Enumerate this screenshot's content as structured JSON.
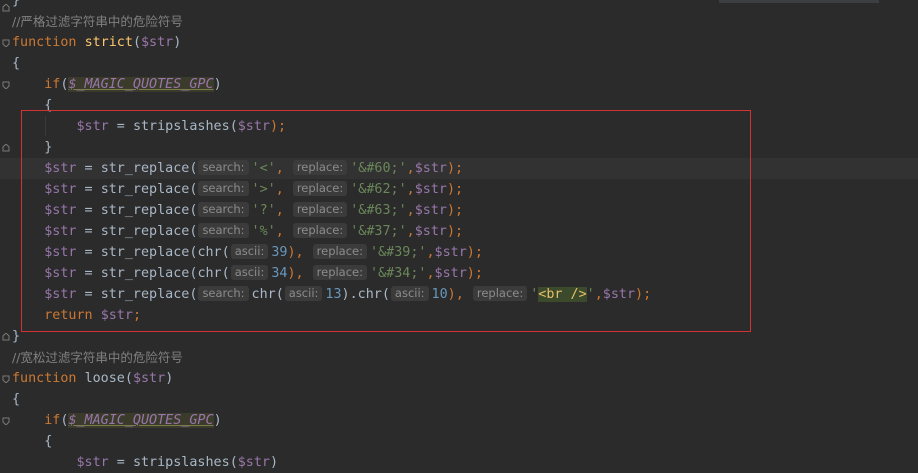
{
  "editor": {
    "lines": {
      "l0": "}",
      "c1": "//严格过滤字符串中的危险符号",
      "f1_kw": "function",
      "f1_name": "strict",
      "f1_open": "(",
      "f1_arg": "$str",
      "f1_close": ")",
      "brace_open": "{",
      "if_kw": "if",
      "if_open": "(",
      "gpc": "$_MAGIC_QUOTES_GPC",
      "if_close": ")",
      "inner_open": "{",
      "ss_var": "$str",
      "ss_eq": " = ",
      "ss_fn": "stripslashes",
      "ss_open": "(",
      "ss_arg": "$str",
      "ss_close": ");",
      "inner_close": "}",
      "r1": {
        "var": "$str",
        "eq": " = ",
        "fn": "str_replace",
        "open": "(",
        "h1": "search:",
        "s1": "'<'",
        "comma": ", ",
        "h2": "replace:",
        "s2": "'&#60;'",
        "tail_comma": ",",
        "arg": "$str",
        "end": ");"
      },
      "r2": {
        "var": "$str",
        "eq": " = ",
        "fn": "str_replace",
        "open": "(",
        "h1": "search:",
        "s1": "'>'",
        "comma": ", ",
        "h2": "replace:",
        "s2": "'&#62;'",
        "tail_comma": ",",
        "arg": "$str",
        "end": ");"
      },
      "r3": {
        "var": "$str",
        "eq": " = ",
        "fn": "str_replace",
        "open": "(",
        "h1": "search:",
        "s1": "'?'",
        "comma": ", ",
        "h2": "replace:",
        "s2": "'&#63;'",
        "tail_comma": ",",
        "arg": "$str",
        "end": ");"
      },
      "r4": {
        "var": "$str",
        "eq": " = ",
        "fn": "str_replace",
        "open": "(",
        "h1": "search:",
        "s1": "'%'",
        "comma": ", ",
        "h2": "replace:",
        "s2": "'&#37;'",
        "tail_comma": ",",
        "arg": "$str",
        "end": ");"
      },
      "r5": {
        "var": "$str",
        "eq": " = ",
        "fn": "str_replace",
        "open": "(",
        "chr": "chr",
        "copen": "(",
        "h1": "ascii:",
        "n1": "39",
        "cclose": "), ",
        "h2": "replace:",
        "s2": "'&#39;'",
        "tail_comma": ",",
        "arg": "$str",
        "end": ");"
      },
      "r6": {
        "var": "$str",
        "eq": " = ",
        "fn": "str_replace",
        "open": "(",
        "chr": "chr",
        "copen": "(",
        "h1": "ascii:",
        "n1": "34",
        "cclose": "), ",
        "h2": "replace:",
        "s2": "'&#34;'",
        "tail_comma": ",",
        "arg": "$str",
        "end": ");"
      },
      "r7": {
        "var": "$str",
        "eq": " = ",
        "fn": "str_replace",
        "open": "(",
        "h0": "search:",
        "chr1": "chr",
        "copen1": "(",
        "h1": "ascii:",
        "n1": "13",
        "mid": ").",
        "chr2": "chr",
        "copen2": "(",
        "h2": "ascii:",
        "n2": "10",
        "cclose2": "), ",
        "h3": "replace:",
        "q1": "'",
        "tag": "<br />",
        "q2": "'",
        "tail_comma": ",",
        "arg": "$str",
        "end": ");"
      },
      "ret_kw": "return",
      "ret_var": "$str",
      "ret_end": ";",
      "brace_close": "}",
      "c2": "//宽松过滤字符串中的危险符号",
      "f2_kw": "function",
      "f2_name": "loose",
      "f2_open": "(",
      "f2_arg": "$str",
      "f2_close": ")",
      "brace_open2": "{",
      "if2_kw": "if",
      "if2_open": "(",
      "gpc2": "$_MAGIC_QUOTES_GPC",
      "if2_close": ")",
      "inner_open2": "{",
      "partial_var": "$str",
      "partial_eq": " = ",
      "partial_fn": "stripslashes",
      "partial_open": "(",
      "partial_arg": "$str",
      "partial_close": ")"
    }
  },
  "colors": {
    "background": "#2b2b2b",
    "keyword": "#cc7832",
    "function": "#ffc66d",
    "variable": "#9876aa",
    "string": "#6a8759",
    "number": "#6897bb",
    "comment": "#808080",
    "highlight_box": "#d23232"
  }
}
